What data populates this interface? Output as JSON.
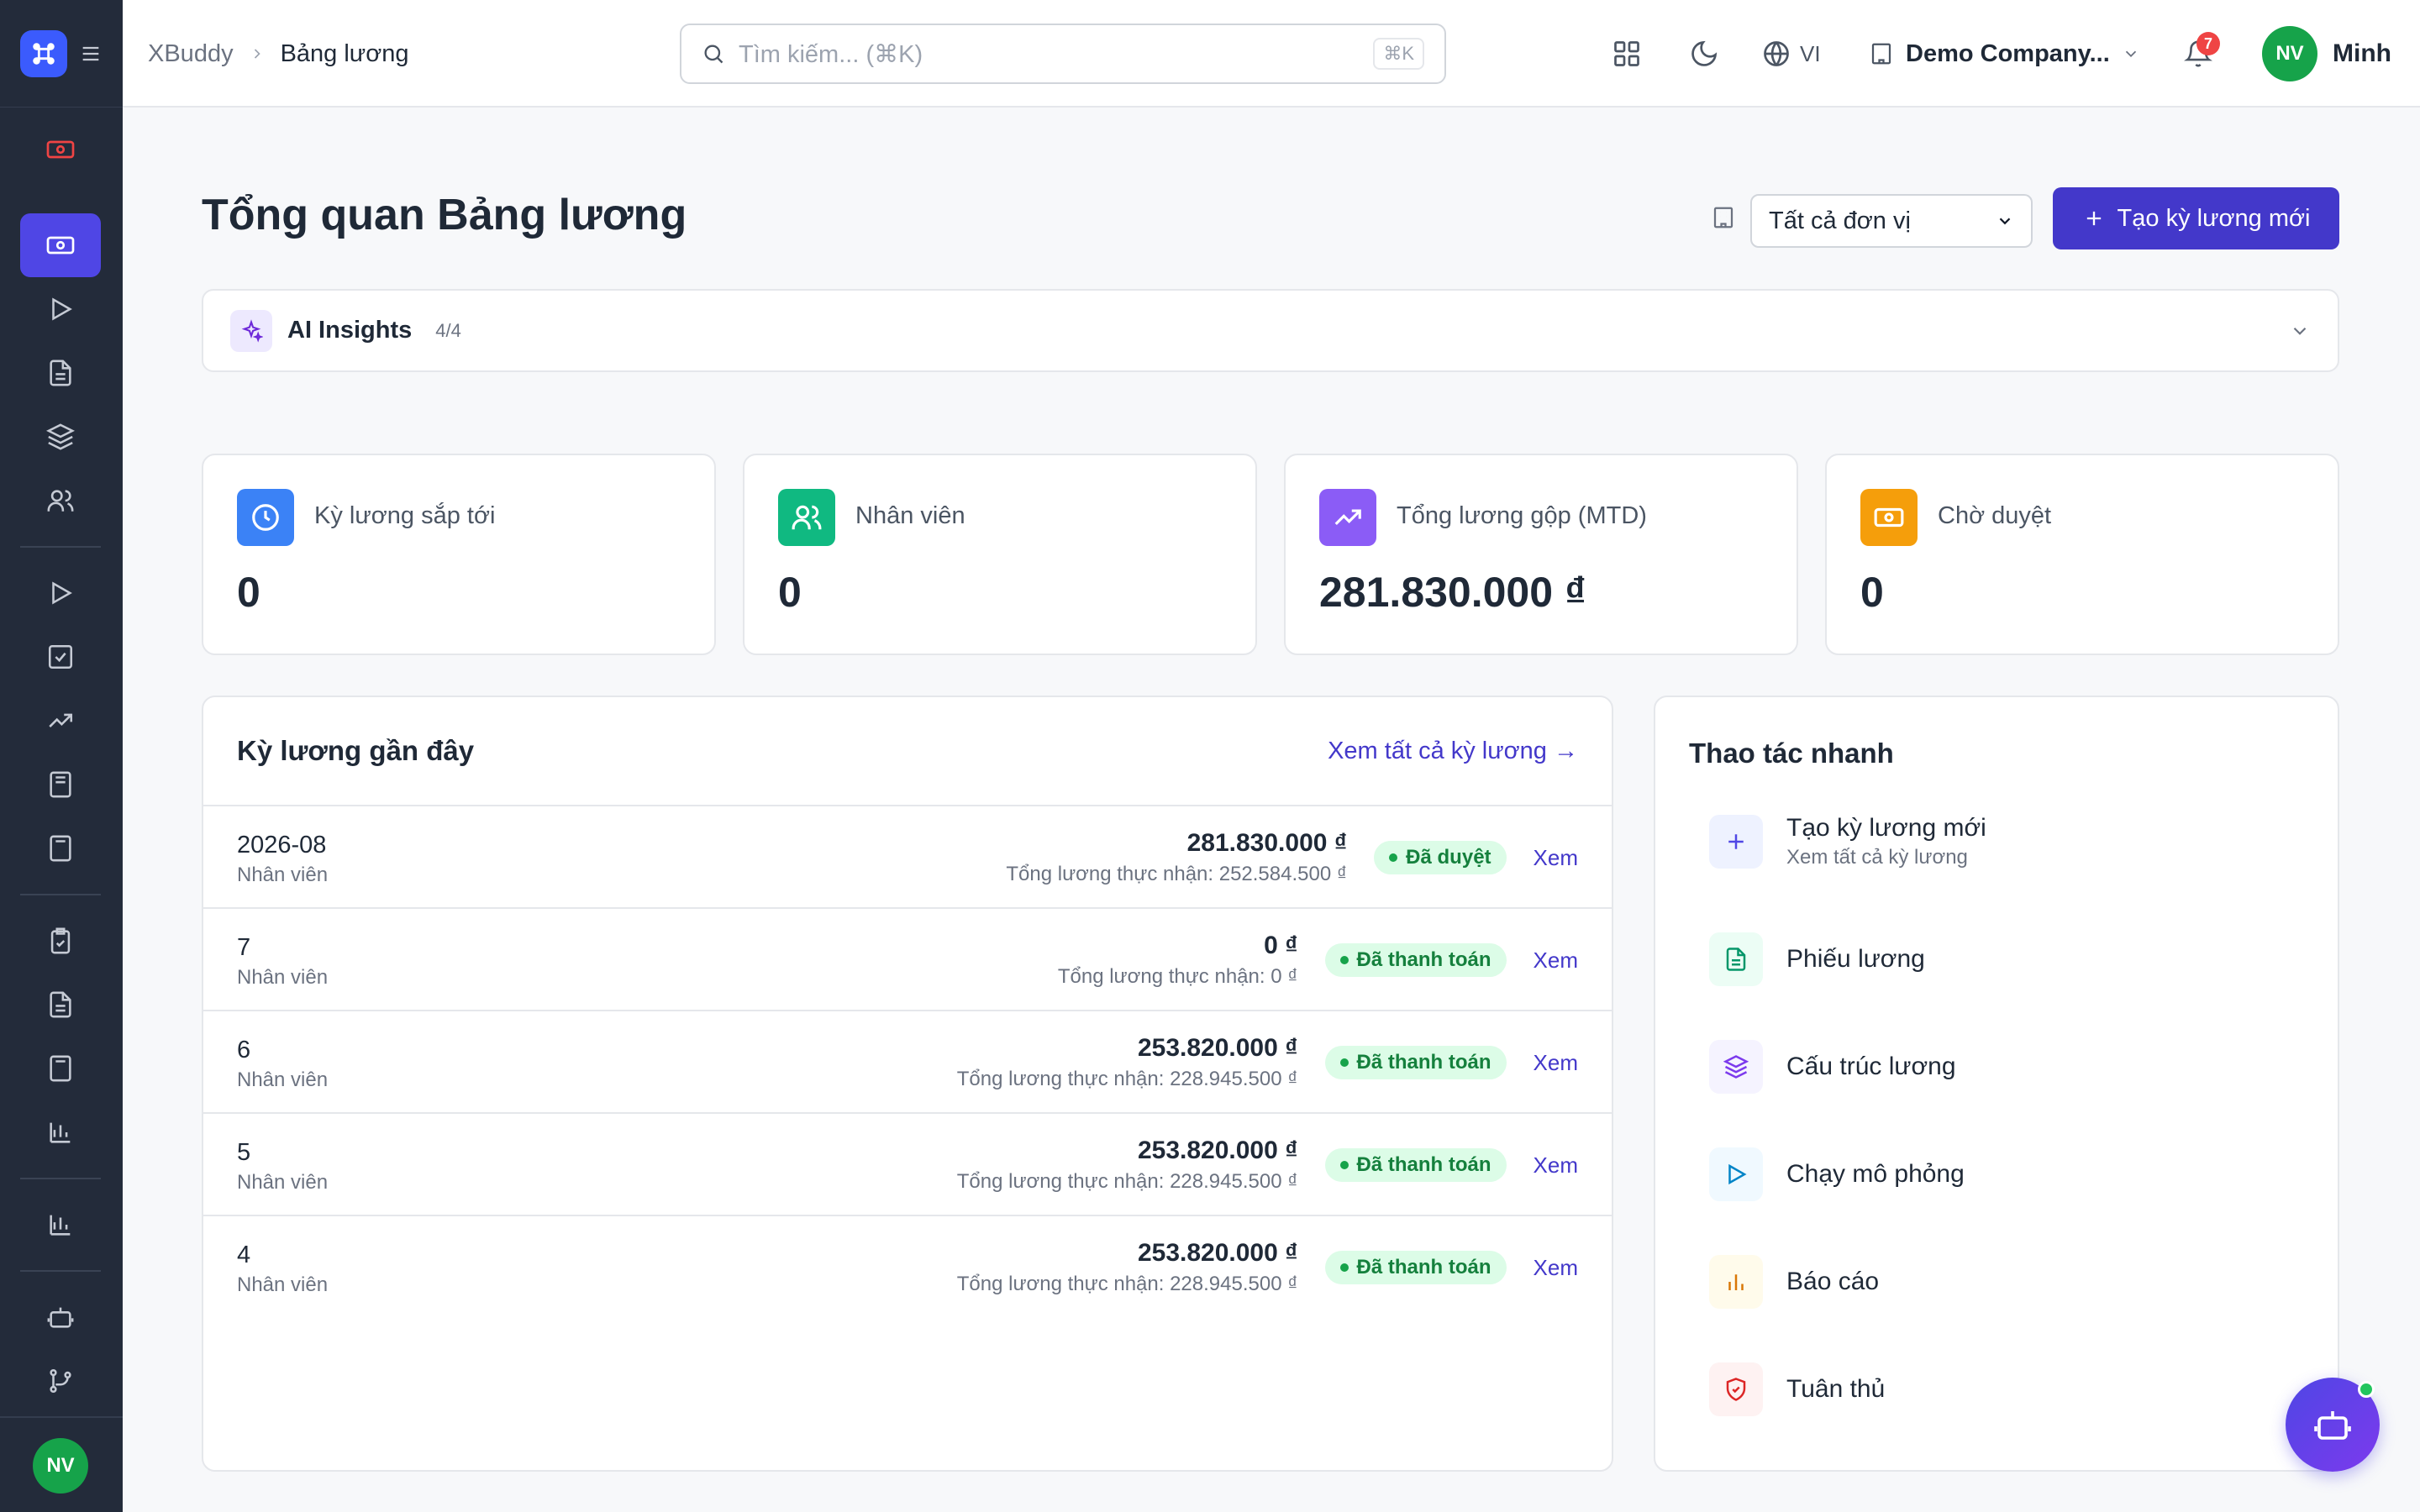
{
  "app": {
    "name": "XBuddy"
  },
  "breadcrumb": {
    "root": "XBuddy",
    "separator": ">",
    "current": "Bảng lương"
  },
  "search": {
    "placeholder": "Tìm kiếm... (⌘K)",
    "shortcut": "⌘K"
  },
  "header": {
    "language": "VI",
    "company": "Demo Company...",
    "notifications_count": "7",
    "user_initials": "NV",
    "user_name": "Minh"
  },
  "sidebar": {
    "avatar_initials": "NV",
    "items": [
      {
        "icon": "money-icon"
      },
      {
        "icon": "money-icon",
        "active": true
      },
      {
        "icon": "play-icon"
      },
      {
        "icon": "document-icon"
      },
      {
        "icon": "layers-icon"
      },
      {
        "icon": "users-icon"
      },
      {
        "icon": "play-icon"
      },
      {
        "icon": "checkbox-icon"
      },
      {
        "icon": "trending-up-icon"
      },
      {
        "icon": "book-icon"
      },
      {
        "icon": "calculator-icon"
      },
      {
        "icon": "clipboard-icon"
      },
      {
        "icon": "document-icon"
      },
      {
        "icon": "calculator-icon"
      },
      {
        "icon": "bar-chart-icon"
      },
      {
        "icon": "bar-chart-icon"
      },
      {
        "icon": "bot-icon"
      },
      {
        "icon": "git-branch-icon"
      }
    ]
  },
  "page": {
    "title": "Tổng quan Bảng lương",
    "unit_select": "Tất cả đơn vị",
    "create_button": "Tạo kỳ lương mới"
  },
  "ai_insights": {
    "title": "AI Insights",
    "count": "4/4"
  },
  "stats": [
    {
      "label": "Kỳ lương sắp tới",
      "value": "0",
      "color": "#3b82f6",
      "icon": "clock-icon"
    },
    {
      "label": "Nhân viên",
      "value": "0",
      "color": "#10b981",
      "icon": "users-icon"
    },
    {
      "label": "Tổng lương gộp (MTD)",
      "value": "281.830.000 ₫",
      "color": "#8b5cf6",
      "icon": "trending-up-icon"
    },
    {
      "label": "Chờ duyệt",
      "value": "0",
      "color": "#f59e0b",
      "icon": "money-icon"
    }
  ],
  "recent": {
    "title": "Kỳ lương gần đây",
    "view_all": "Xem tất cả kỳ lương →",
    "rows": [
      {
        "period": "2026-08",
        "sub": "Nhân viên",
        "gross": "281.830.000 ₫",
        "net": "Tổng lương thực nhận: 252.584.500 ₫",
        "status": "Đã duyệt",
        "action": "Xem"
      },
      {
        "period": "7",
        "sub": "Nhân viên",
        "gross": "0 ₫",
        "net": "Tổng lương thực nhận: 0 ₫",
        "status": "Đã thanh toán",
        "action": "Xem"
      },
      {
        "period": "6",
        "sub": "Nhân viên",
        "gross": "253.820.000 ₫",
        "net": "Tổng lương thực nhận: 228.945.500 ₫",
        "status": "Đã thanh toán",
        "action": "Xem"
      },
      {
        "period": "5",
        "sub": "Nhân viên",
        "gross": "253.820.000 ₫",
        "net": "Tổng lương thực nhận: 228.945.500 ₫",
        "status": "Đã thanh toán",
        "action": "Xem"
      },
      {
        "period": "4",
        "sub": "Nhân viên",
        "gross": "253.820.000 ₫",
        "net": "Tổng lương thực nhận: 228.945.500 ₫",
        "status": "Đã thanh toán",
        "action": "Xem"
      }
    ]
  },
  "quick_actions": {
    "title": "Thao tác nhanh",
    "items": [
      {
        "label": "Tạo kỳ lương mới",
        "sub": "Xem tất cả kỳ lương",
        "icon": "plus-icon",
        "color": "#4f46e5",
        "bg": "#eef2ff"
      },
      {
        "label": "Phiếu lương",
        "icon": "document-icon",
        "color": "#059669",
        "bg": "#ecfdf5"
      },
      {
        "label": "Cấu trúc lương",
        "icon": "layers-icon",
        "color": "#7c3aed",
        "bg": "#f5f3ff"
      },
      {
        "label": "Chạy mô phỏng",
        "icon": "play-icon",
        "color": "#0284c7",
        "bg": "#f0f9ff"
      },
      {
        "label": "Báo cáo",
        "icon": "bar-chart-icon",
        "color": "#d97706",
        "bg": "#fffbeb"
      },
      {
        "label": "Tuân thủ",
        "icon": "shield-icon",
        "color": "#dc2626",
        "bg": "#fef2f2"
      }
    ]
  }
}
